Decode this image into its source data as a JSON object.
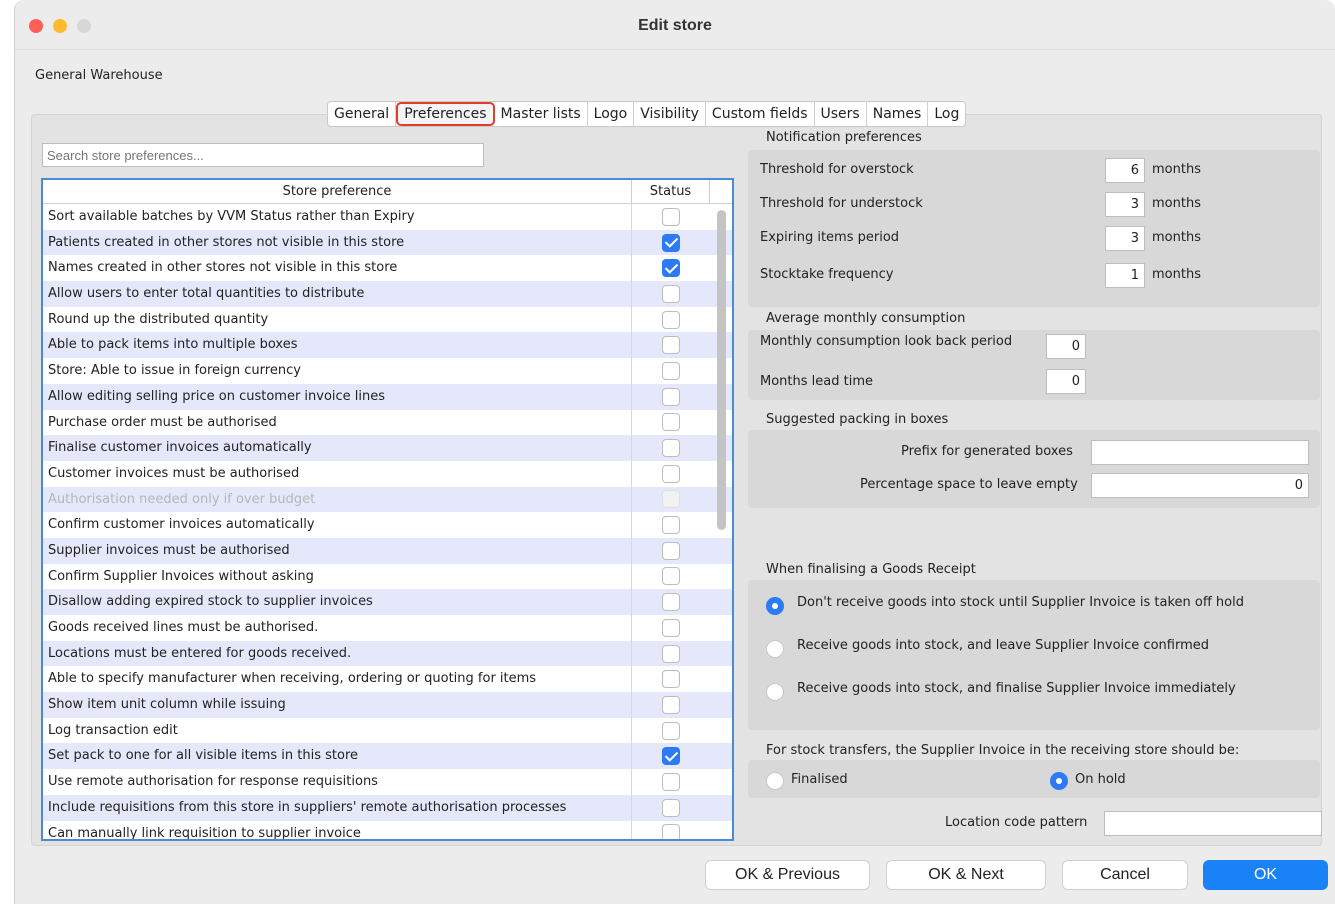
{
  "window": {
    "title": "Edit store"
  },
  "store_name": "General Warehouse",
  "tabs": [
    "General",
    "Preferences",
    "Master lists",
    "Logo",
    "Visibility",
    "Custom fields",
    "Users",
    "Names",
    "Log"
  ],
  "active_tab": "Preferences",
  "search": {
    "placeholder": "Search store preferences...",
    "value": ""
  },
  "table": {
    "headers": {
      "preference": "Store preference",
      "status": "Status"
    },
    "rows": [
      {
        "label": "Sort available batches by VVM Status rather than Expiry",
        "checked": false,
        "disabled": false
      },
      {
        "label": "Patients created in other stores not visible in this store",
        "checked": true,
        "disabled": false
      },
      {
        "label": "Names created in other stores not visible in this store",
        "checked": true,
        "disabled": false
      },
      {
        "label": "Allow users to enter total quantities to distribute",
        "checked": false,
        "disabled": false
      },
      {
        "label": "Round up the distributed quantity",
        "checked": false,
        "disabled": false
      },
      {
        "label": "Able to pack items into multiple boxes",
        "checked": false,
        "disabled": false
      },
      {
        "label": "Store: Able to issue in foreign currency",
        "checked": false,
        "disabled": false
      },
      {
        "label": "Allow editing selling price on customer invoice lines",
        "checked": false,
        "disabled": false
      },
      {
        "label": "Purchase order must be authorised",
        "checked": false,
        "disabled": false
      },
      {
        "label": "Finalise customer invoices automatically",
        "checked": false,
        "disabled": false
      },
      {
        "label": "Customer invoices must be authorised",
        "checked": false,
        "disabled": false
      },
      {
        "label": "Authorisation needed only if over budget",
        "checked": false,
        "disabled": true
      },
      {
        "label": "Confirm customer invoices automatically",
        "checked": false,
        "disabled": false
      },
      {
        "label": "Supplier invoices must be authorised",
        "checked": false,
        "disabled": false
      },
      {
        "label": "Confirm Supplier Invoices without asking",
        "checked": false,
        "disabled": false
      },
      {
        "label": "Disallow adding expired stock to supplier invoices",
        "checked": false,
        "disabled": false
      },
      {
        "label": "Goods received lines must be authorised.",
        "checked": false,
        "disabled": false
      },
      {
        "label": "Locations must be entered for goods received.",
        "checked": false,
        "disabled": false
      },
      {
        "label": "Able to specify manufacturer when receiving, ordering or quoting for items",
        "checked": false,
        "disabled": false
      },
      {
        "label": "Show item unit column while issuing",
        "checked": false,
        "disabled": false
      },
      {
        "label": "Log transaction edit",
        "checked": false,
        "disabled": false
      },
      {
        "label": "Set pack to one for all visible items in this store",
        "checked": true,
        "disabled": false
      },
      {
        "label": "Use remote authorisation for response requisitions",
        "checked": false,
        "disabled": false
      },
      {
        "label": "Include requisitions from this store in suppliers' remote authorisation processes",
        "checked": false,
        "disabled": false
      },
      {
        "label": "Can manually link requisition to supplier invoice",
        "checked": false,
        "disabled": false
      }
    ]
  },
  "notification": {
    "title": "Notification preferences",
    "overstock": {
      "label": "Threshold for overstock",
      "value": "6",
      "unit": "months"
    },
    "understock": {
      "label": "Threshold for understock",
      "value": "3",
      "unit": "months"
    },
    "expiring": {
      "label": "Expiring items period",
      "value": "3",
      "unit": "months"
    },
    "stocktake": {
      "label": "Stocktake frequency",
      "value": "1",
      "unit": "months"
    }
  },
  "amc": {
    "title": "Average monthly consumption",
    "lookback": {
      "label": "Monthly consumption look back period",
      "value": "0"
    },
    "leadtime": {
      "label": "Months lead time",
      "value": "0"
    }
  },
  "packing": {
    "title": "Suggested packing in boxes",
    "prefix": {
      "label": "Prefix for generated boxes",
      "value": ""
    },
    "space": {
      "label": "Percentage space to leave empty",
      "value": "0"
    }
  },
  "goods_receipt": {
    "title": "When finalising a Goods Receipt",
    "options": [
      "Don't receive goods into stock until Supplier Invoice is taken off hold",
      "Receive goods into stock, and leave Supplier Invoice confirmed",
      "Receive goods into stock, and finalise Supplier Invoice immediately"
    ],
    "selected": 0
  },
  "transfers": {
    "title": "For stock transfers, the Supplier Invoice in the receiving store should be:",
    "finalised": "Finalised",
    "on_hold": "On hold",
    "selected": "on_hold"
  },
  "location_code": {
    "label": "Location code pattern",
    "value": ""
  },
  "buttons": {
    "ok_previous": "OK & Previous",
    "ok_next": "OK & Next",
    "cancel": "Cancel",
    "ok": "OK"
  },
  "colors": {
    "accent": "#1a82f7",
    "table_border": "#4a8ad8",
    "active_tab_outline": "#e0402a",
    "row_alt": "#e5e8fb"
  }
}
